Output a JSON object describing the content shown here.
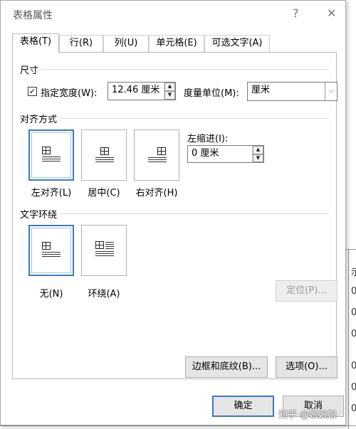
{
  "window": {
    "title": "表格属性",
    "help": "?",
    "close": "✕"
  },
  "tabs": [
    {
      "label": "表格(T)",
      "active": true
    },
    {
      "label": "行(R)",
      "active": false
    },
    {
      "label": "列(U)",
      "active": false
    },
    {
      "label": "单元格(E)",
      "active": false
    },
    {
      "label": "可选文字(A)",
      "active": false
    }
  ],
  "size": {
    "group_label": "尺寸",
    "checkbox_label": "指定宽度(W):",
    "checkbox_checked": true,
    "width_value": "12.46 厘米",
    "unit_label": "度量单位(M):",
    "unit_value": "厘米"
  },
  "alignment": {
    "group_label": "对齐方式",
    "options": [
      "左对齐(L)",
      "居中(C)",
      "右对齐(H)"
    ],
    "selected": "左对齐(L)",
    "indent_label": "左缩进(I):",
    "indent_value": "0 厘米"
  },
  "wrapping": {
    "group_label": "文字环绕",
    "options": [
      "无(N)",
      "环绕(A)"
    ],
    "selected": "无(N)",
    "position_button": "定位(P)..."
  },
  "buttons": {
    "borders": "边框和底纹(B)...",
    "options": "选项(O)...",
    "ok": "确定",
    "cancel": "取消"
  },
  "background": {
    "cells": [
      "示",
      "0",
      "0",
      "0",
      "0",
      "0",
      "0"
    ],
    "watermark": "知乎 @娘娘娘"
  },
  "icons": {
    "checkbox": "checkmark-icon",
    "spin_up": "triangle-up-icon",
    "spin_down": "triangle-down-icon",
    "dropdown": "chevron-down-icon"
  },
  "colors": {
    "selection_border": "#3d7ab8",
    "button_face": "#e5e5e5"
  }
}
